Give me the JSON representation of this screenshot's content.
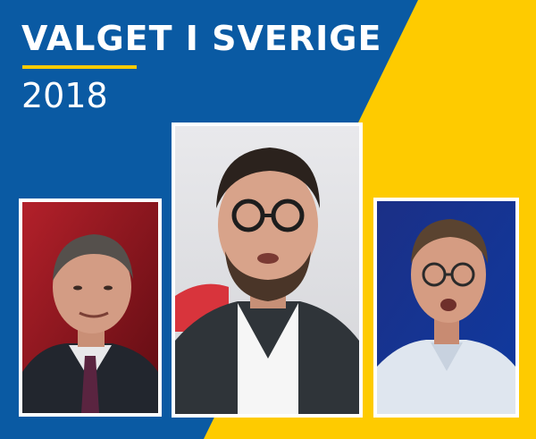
{
  "header": {
    "title": "VALGET I SVERIGE",
    "year": "2018"
  },
  "colors": {
    "blue": "#0a5aa3",
    "yellow": "#fecb00",
    "white": "#ffffff"
  },
  "photos": [
    {
      "icon": "portrait-photo"
    },
    {
      "icon": "portrait-photo"
    },
    {
      "icon": "portrait-photo"
    }
  ]
}
